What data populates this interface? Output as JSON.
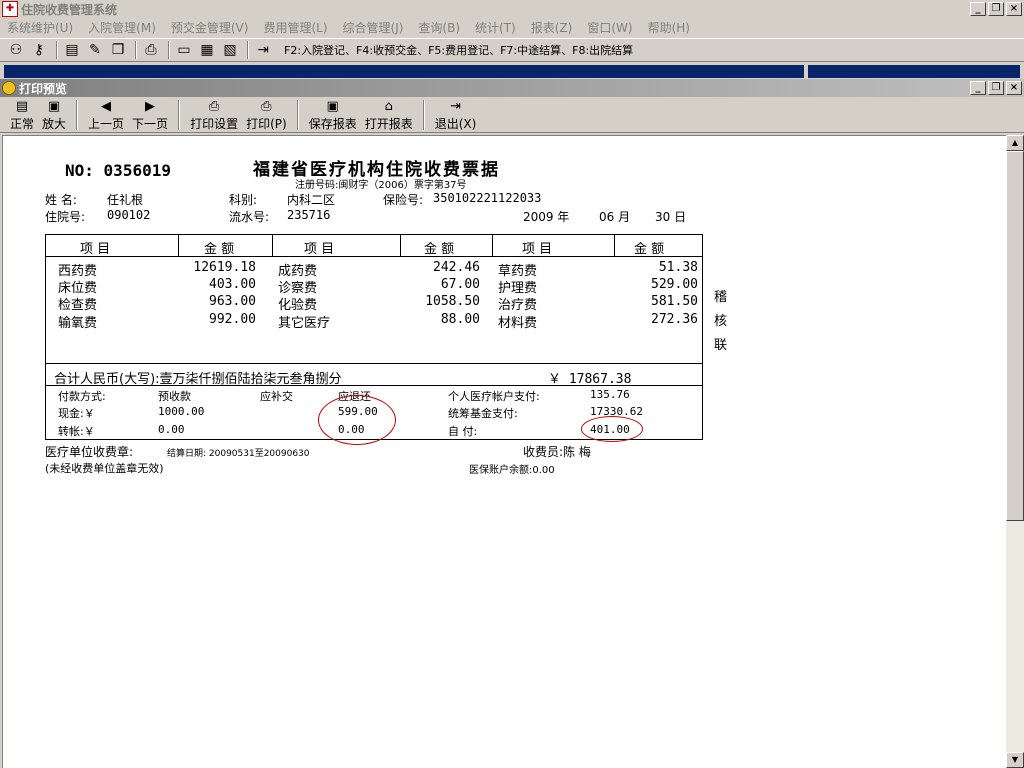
{
  "app": {
    "title": "住院收费管理系统",
    "icon": "hospital-app-icon"
  },
  "window_buttons": [
    "_",
    "❐",
    "×"
  ],
  "menu": [
    "系统维护(U)",
    "入院管理(M)",
    "预交金管理(V)",
    "费用管理(L)",
    "综合管理(J)",
    "查询(B)",
    "统计(T)",
    "报表(Z)",
    "窗口(W)",
    "帮助(H)"
  ],
  "toolbar": {
    "icons": [
      "users-icon",
      "key-icon",
      "document-icon",
      "edit-icon",
      "copy-icon",
      "printer-icon",
      "card-icon",
      "calculator-icon",
      "form-icon",
      "exit-icon"
    ],
    "hint": "F2:入院登记、F4:收预交金、F5:费用登记、F7:中途结算、F8:出院结算"
  },
  "preview": {
    "title": "打印预览",
    "buttons": [
      "正常",
      "放大",
      "上一页",
      "下一页",
      "打印设置",
      "打印(P)",
      "保存报表",
      "打开报表",
      "退出(X)"
    ]
  },
  "receipt": {
    "no_label": "NO:",
    "no": "0356019",
    "title": "福建省医疗机构住院收费票据",
    "reg": "注册号码:闽财字（2006）票字第37号",
    "name_label": "姓    名:",
    "name": "任礼根",
    "dept_label": "科别:",
    "dept": "内科二区",
    "ins_label": "保险号:",
    "ins_no": "350102221122033",
    "inpatient_label": "住院号:",
    "inpatient_no": "090102",
    "serial_label": "流水号:",
    "serial_no": "235716",
    "date_year": "2009 年",
    "date_month": "06 月",
    "date_day": "30 日",
    "col_item": "项      目",
    "col_amount": "金   额",
    "items": [
      [
        {
          "n": "西药费",
          "v": "12619.18"
        },
        {
          "n": "成药费",
          "v": "242.46"
        },
        {
          "n": "草药费",
          "v": "51.38"
        }
      ],
      [
        {
          "n": "床位费",
          "v": "403.00"
        },
        {
          "n": "诊察费",
          "v": "67.00"
        },
        {
          "n": "护理费",
          "v": "529.00"
        }
      ],
      [
        {
          "n": "检查费",
          "v": "963.00"
        },
        {
          "n": "化验费",
          "v": "1058.50"
        },
        {
          "n": "治疗费",
          "v": "581.50"
        }
      ],
      [
        {
          "n": "输氧费",
          "v": "992.00"
        },
        {
          "n": "其它医疗",
          "v": "88.00"
        },
        {
          "n": "材料费",
          "v": "272.36"
        }
      ]
    ],
    "total_label": "合计人民币(大写):壹万柒仟捌佰陆拾柒元叁角捌分",
    "total_value": "￥ 17867.38",
    "pay_method_label": "付款方式:",
    "prepaid_label": "预收款",
    "supplement_label": "应补交",
    "refund_label": "应退还",
    "personal_label": "个人医疗帐户支付:",
    "personal_value": "135.76",
    "cash_label": "现金:￥",
    "cash_value": "1000.00",
    "refund_cash": "599.00",
    "fund_label": "统筹基金支付:",
    "fund_value": "17330.62",
    "transfer_label": "转帐:￥",
    "transfer_value": "0.00",
    "refund_transfer": "0.00",
    "self_label": "自          付:",
    "self_value": "401.00",
    "stamp_label": "医疗单位收费章:",
    "settle_dates": "结算日期: 20090531至20090630",
    "cashier": "收费员:陈  梅",
    "note": "(未经收费单位盖章无效)",
    "balance": "医保账户余额:0.00",
    "side_chars": [
      "稽",
      "核",
      "联"
    ]
  }
}
